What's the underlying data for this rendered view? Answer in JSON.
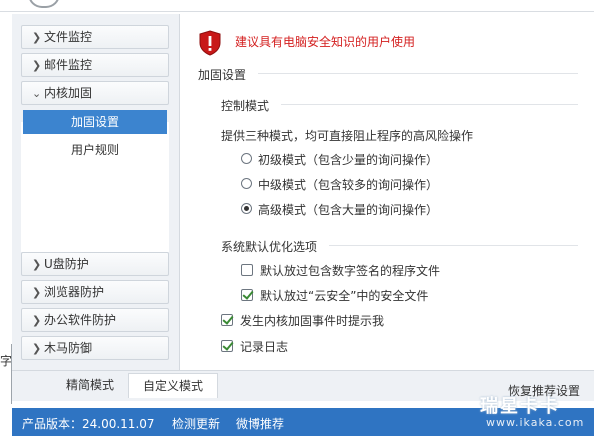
{
  "sidebar": {
    "items_top": [
      {
        "label": "文件监控",
        "expanded": false
      },
      {
        "label": "邮件监控",
        "expanded": false
      },
      {
        "label": "内核加固",
        "expanded": true
      }
    ],
    "sub_items": [
      {
        "label": "加固设置",
        "active": true
      },
      {
        "label": "用户规则",
        "active": false
      }
    ],
    "items_bottom": [
      {
        "label": "U盘防护"
      },
      {
        "label": "浏览器防护"
      },
      {
        "label": "办公软件防护"
      },
      {
        "label": "木马防御"
      }
    ]
  },
  "left_edge_char": "字",
  "content": {
    "warning": "建议具有电脑安全知识的用户使用",
    "section_title": "加固设置",
    "control_mode": {
      "title": "控制模式",
      "description": "提供三种模式，均可直接阻止程序的高风险操作",
      "options": [
        {
          "label": "初级模式（包含少量的询问操作）",
          "selected": false
        },
        {
          "label": "中级模式（包含较多的询问操作）",
          "selected": false
        },
        {
          "label": "高级模式（包含大量的询问操作）",
          "selected": true
        }
      ]
    },
    "optimize": {
      "title": "系统默认优化选项",
      "options": [
        {
          "label": "默认放过包含数字签名的程序文件",
          "checked": false
        },
        {
          "label": "默认放过“云安全”中的安全文件",
          "checked": true
        }
      ]
    },
    "notify": {
      "label": "发生内核加固事件时提示我",
      "checked": true
    },
    "log": {
      "label": "记录日志",
      "checked": true
    }
  },
  "tabs": [
    {
      "label": "精简模式",
      "active": false
    },
    {
      "label": "自定义模式",
      "active": true
    }
  ],
  "restore_label": "恢复推荐设置",
  "footer": {
    "version": "产品版本：24.00.11.07",
    "check_update": "检测更新",
    "weibo": "微博推荐"
  },
  "watermark": {
    "brand": "瑞星卡卡",
    "url": "www.ikaka.com"
  },
  "colors": {
    "accent": "#3c84cf",
    "footer": "#2f74c2",
    "warning": "#d42020",
    "check": "#3a8a34"
  }
}
